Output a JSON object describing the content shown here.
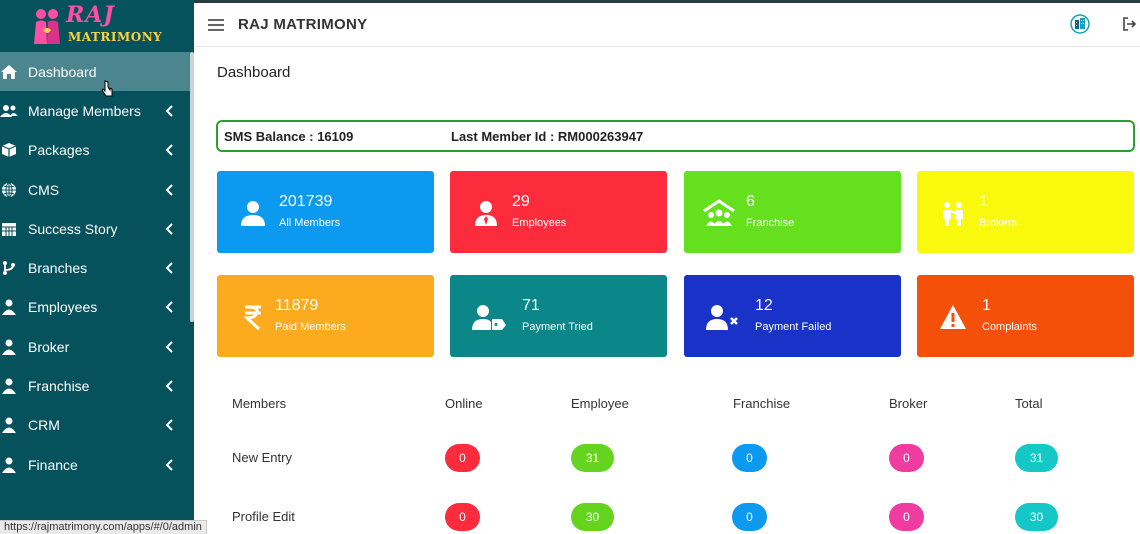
{
  "brand": {
    "name_line1": "RAJ",
    "name_line2": "MATRIMONY"
  },
  "sidebar": {
    "items": [
      {
        "label": "Dashboard",
        "icon": "home-icon",
        "active": true
      },
      {
        "label": "Manage Members",
        "icon": "users-icon"
      },
      {
        "label": "Packages",
        "icon": "box-icon"
      },
      {
        "label": "CMS",
        "icon": "globe-icon"
      },
      {
        "label": "Success Story",
        "icon": "calendar-icon"
      },
      {
        "label": "Branches",
        "icon": "branch-icon"
      },
      {
        "label": "Employees",
        "icon": "user-icon"
      },
      {
        "label": "Broker",
        "icon": "user-icon"
      },
      {
        "label": "Franchise",
        "icon": "user-icon"
      },
      {
        "label": "CRM",
        "icon": "user-icon"
      },
      {
        "label": "Finance",
        "icon": "user-icon"
      }
    ]
  },
  "status_url": "https://rajmatrimony.com/apps/#/0/admin",
  "topbar": {
    "title": "RAJ MATRIMONY",
    "icons": [
      "building-icon",
      "logout-icon"
    ]
  },
  "page": {
    "title": "Dashboard"
  },
  "sms": {
    "balance": "SMS Balance : 16109",
    "last_member": "Last Member Id : RM000263947"
  },
  "cards": [
    {
      "value": "201739",
      "label": "All Members",
      "color": "#0c9af0",
      "icon": "user-icon"
    },
    {
      "value": "29",
      "label": "Employees",
      "color": "#fc2c3c",
      "icon": "employee-icon"
    },
    {
      "value": "6",
      "label": "Franchise",
      "color": "#64e01e",
      "icon": "franchise-icon"
    },
    {
      "value": "1",
      "label": "Brokers",
      "color": "#f9f90e",
      "icon": "brokers-icon"
    },
    {
      "value": "11879",
      "label": "Paid Members",
      "color": "#fcaa1e",
      "icon": "rupee-icon"
    },
    {
      "value": "71",
      "label": "Payment Tried",
      "color": "#0b878a",
      "icon": "user-tag-icon"
    },
    {
      "value": "12",
      "label": "Payment Failed",
      "color": "#1932c8",
      "icon": "user-times-icon"
    },
    {
      "value": "1",
      "label": "Complaints",
      "color": "#f5500a",
      "icon": "warning-icon"
    }
  ],
  "table": {
    "headers": [
      "Members",
      "Online",
      "Employee",
      "Franchise",
      "Broker",
      "Total"
    ],
    "rows": [
      {
        "label": "New Entry",
        "values": [
          "0",
          "31",
          "0",
          "0",
          "31"
        ]
      },
      {
        "label": "Profile Edit",
        "values": [
          "0",
          "30",
          "0",
          "0",
          "30"
        ]
      }
    ],
    "pill_colors": [
      "#fc2c3c",
      "#64d41e",
      "#0c9af0",
      "#f03ca0",
      "#14c8c8"
    ]
  }
}
